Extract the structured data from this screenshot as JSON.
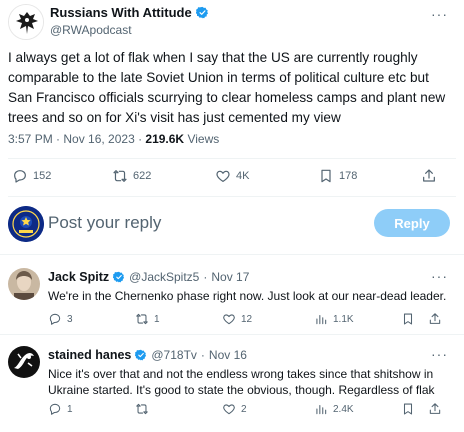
{
  "main_tweet": {
    "author_name": "Russians With Attitude",
    "author_handle": "@RWApodcast",
    "more_label": "···",
    "text": "I always get a lot of flak when I say that the US are currently roughly comparable to the late Soviet Union in terms of political culture etc but San Francisco officials scurrying to clear homeless camps and plant new trees and so on for Xi's visit has just cemented my view",
    "timestamp": "3:57 PM · Nov 16, 2023 · ",
    "views_count": "219.6K",
    "views_label": " Views",
    "stats": {
      "replies": "152",
      "reposts": "622",
      "likes": "4K",
      "bookmarks": "178"
    }
  },
  "reply_composer": {
    "placeholder": "Post your reply",
    "button_label": "Reply"
  },
  "replies": [
    {
      "name": "Jack Spitz",
      "handle": "@JackSpitz5",
      "dot": "·",
      "date": "Nov 17",
      "text": "We're in the Chernenko phase right now. Just look at our near-dead leader.",
      "stats": {
        "replies": "3",
        "reposts": "1",
        "likes": "12",
        "views": "1.1K"
      },
      "more_label": "···"
    },
    {
      "name": "stained hanes",
      "handle": "@718Tv",
      "dot": "·",
      "date": "Nov 16",
      "text": "Nice it's over that and not the endless wrong takes since that shitshow in Ukraine started. It's good to state the obvious, though. Regardless of flak",
      "stats": {
        "replies": "1",
        "reposts": "",
        "likes": "2",
        "views": "2.4K"
      },
      "more_label": "···"
    }
  ],
  "colors": {
    "verified": "#1d9bf0",
    "reply_button": "#8ecdf8",
    "muted_text": "#536471",
    "divider": "#eff3f4"
  }
}
